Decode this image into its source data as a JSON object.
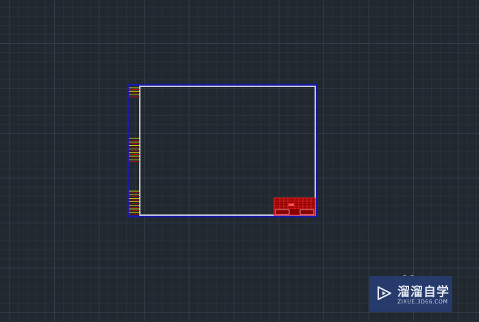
{
  "app": "AutoCAD drawing canvas",
  "colors": {
    "background": "#212830",
    "grid_minor": "#2a323b",
    "grid_major": "#343d48",
    "frame_outer": "#1a1aa8",
    "frame_inner": "#ffffff",
    "title_block": "#e00000",
    "binding_lines": "#ffff00"
  },
  "watermark": {
    "title": "溜溜自学",
    "subtitle": "ZIXUE.3D66.COM",
    "icon": "play-icon"
  }
}
